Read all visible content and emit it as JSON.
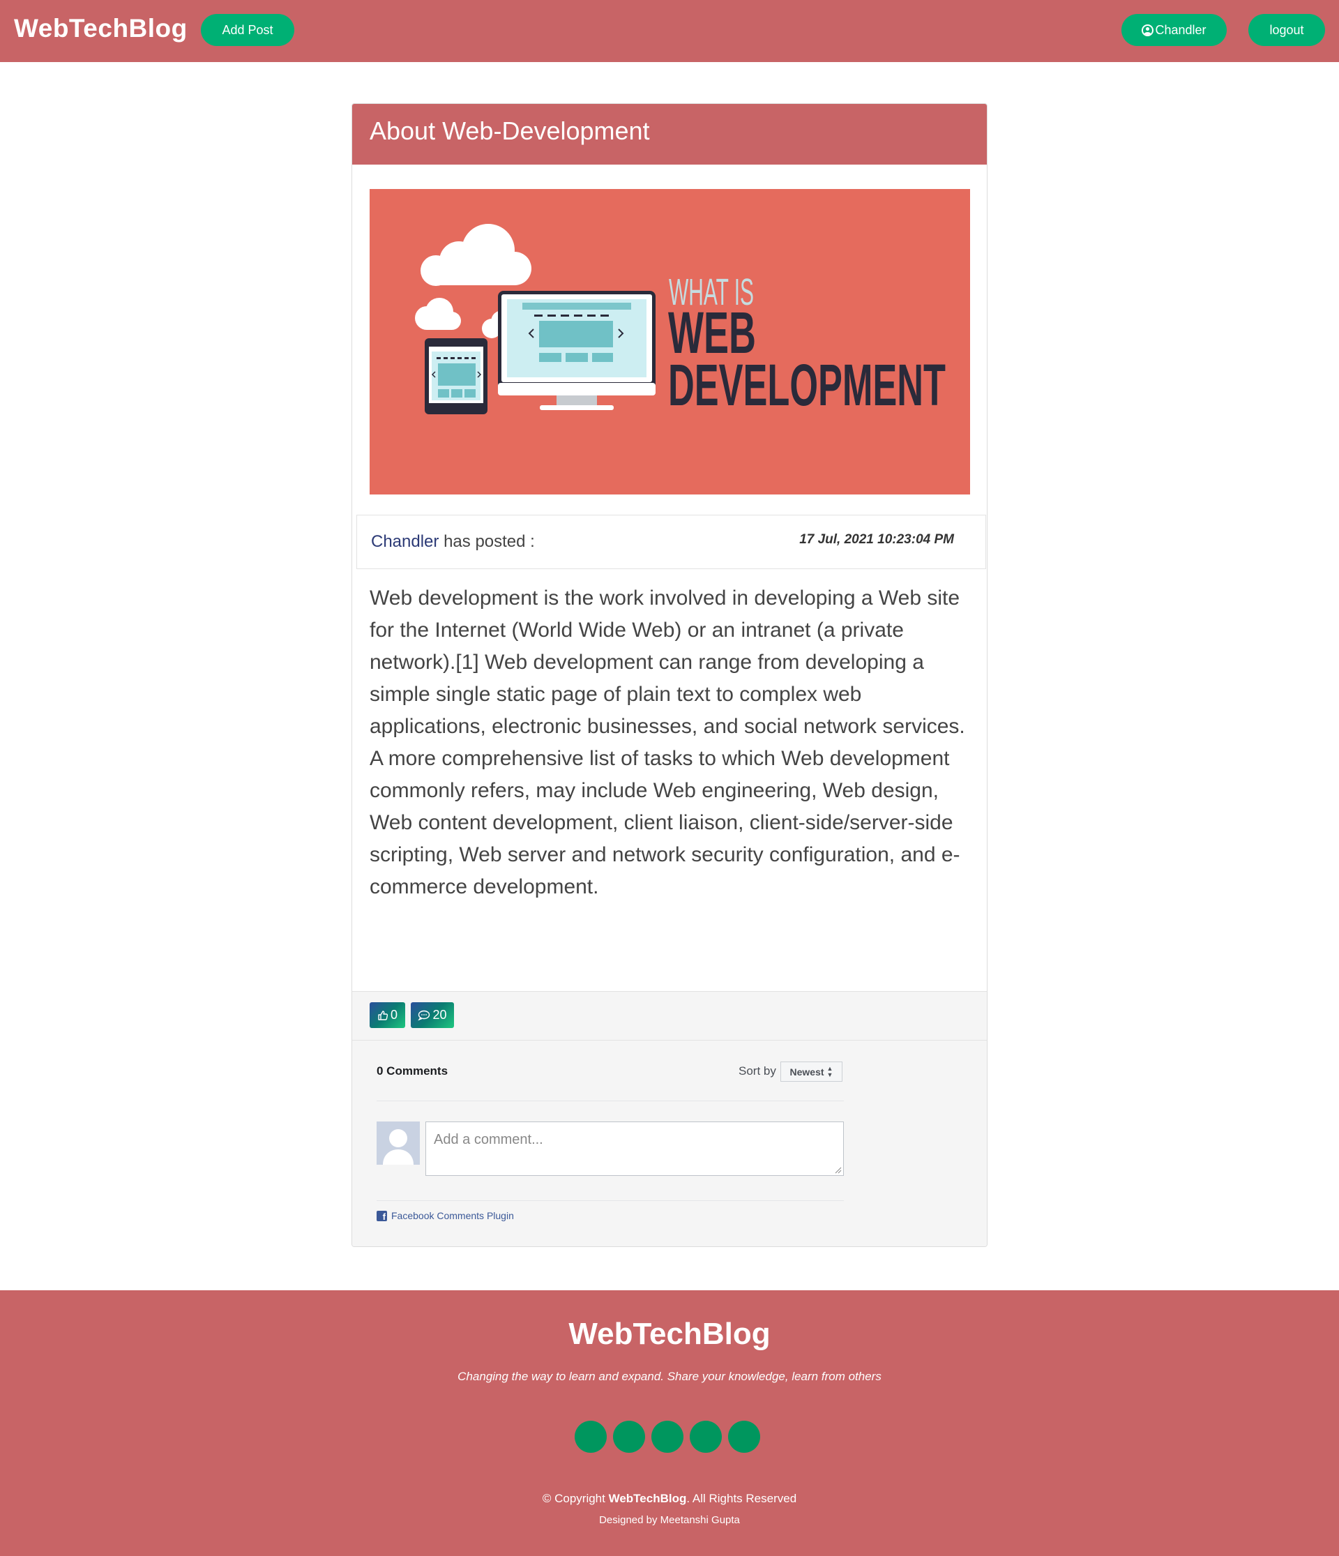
{
  "navbar": {
    "brand": "WebTechBlog",
    "add_post_label": "Add Post",
    "user_label": "Chandler",
    "logout_label": "logout",
    "colors": {
      "bar": "#c86466",
      "button": "#00b074"
    }
  },
  "post": {
    "title": "About Web-Development",
    "banner": {
      "kicker": "WHAT IS",
      "line1": "WEB",
      "line2": "DEVELOPMENT",
      "background": "#e56b5d",
      "illustration_icons": [
        "cloud-icon",
        "monitor-icon",
        "tablet-icon"
      ]
    },
    "author": "Chandler",
    "posted_suffix": "has posted :",
    "date": "17 Jul, 2021 10:23:04 PM",
    "body": "Web development is the work involved in developing a Web site for the Internet (World Wide Web) or an intranet (a private network).[1] Web development can range from developing a simple single static page of plain text to complex web applications, electronic businesses, and social network services. A more comprehensive list of tasks to which Web development commonly refers, may include Web engineering, Web design, Web content development, client liaison, client-side/server-side scripting, Web server and network security configuration, and e-commerce development.",
    "likes": "0",
    "comments": "20",
    "icons": {
      "likes": "thumbs-up-icon",
      "comments": "chat-bubble-icon"
    }
  },
  "fb_comments": {
    "count_label": "0 Comments",
    "sort_label": "Sort by",
    "sort_value": "Newest",
    "placeholder": "Add a comment...",
    "plugin_label": "Facebook Comments Plugin"
  },
  "footer": {
    "brand": "WebTechBlog",
    "tagline": "Changing the way to learn and expand. Share your knowledge, learn from others",
    "social_count": 5,
    "copyright_prefix": "© Copyright",
    "copyright_brand": "WebTechBlog",
    "copyright_suffix": ". All Rights Reserved",
    "designed_by": "Designed by Meetanshi Gupta",
    "colors": {
      "social": "#00965e"
    }
  }
}
